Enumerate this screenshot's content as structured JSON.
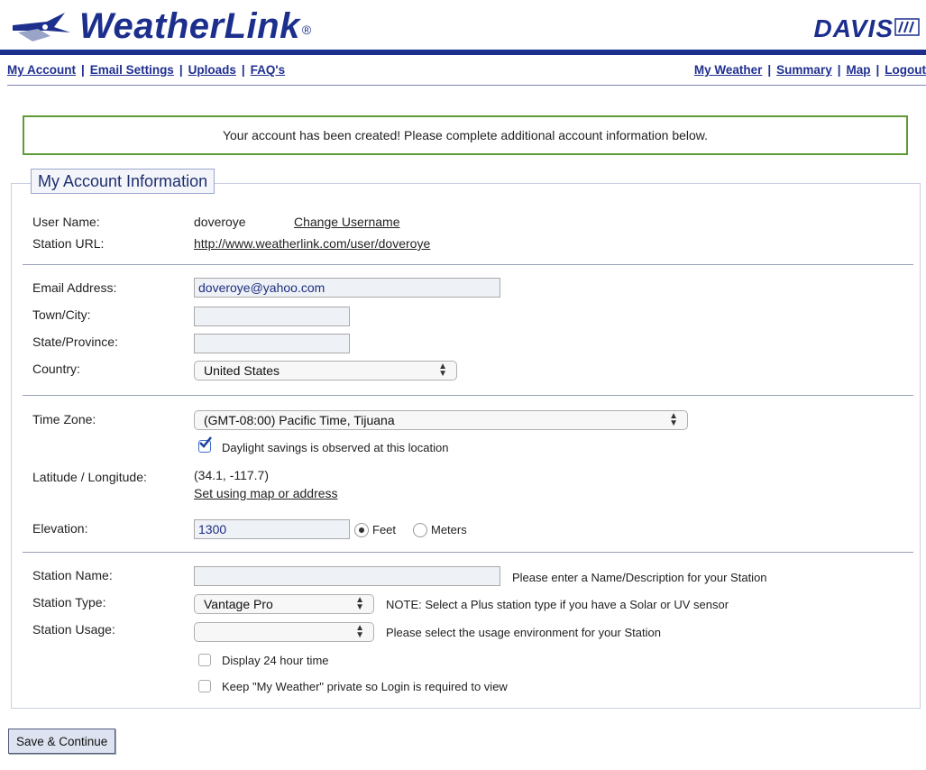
{
  "header": {
    "logo_text": "WeatherLink",
    "logo_mark": "®",
    "brand_text": "DAVIS"
  },
  "nav": {
    "left": [
      "My Account",
      "Email Settings",
      "Uploads",
      "FAQ's"
    ],
    "right": [
      "My Weather",
      "Summary",
      "Map",
      "Logout"
    ],
    "separator": "|"
  },
  "notice": {
    "text": "Your account has been created! Please complete additional account information below."
  },
  "panel": {
    "title": "My Account Information"
  },
  "account": {
    "user_name_label": "User Name:",
    "user_name_value": "doveroye",
    "change_username_link": "Change Username",
    "station_url_label": "Station URL:",
    "station_url_value": "http://www.weatherlink.com/user/doveroye"
  },
  "contact": {
    "email_label": "Email Address:",
    "email_value": "doveroye@yahoo.com",
    "town_label": "Town/City:",
    "town_value": "",
    "state_label": "State/Province:",
    "state_value": "",
    "country_label": "Country:",
    "country_value": "United States"
  },
  "location": {
    "time_zone_label": "Time Zone:",
    "time_zone_value": "(GMT-08:00) Pacific Time, Tijuana",
    "dst_label": "Daylight savings is observed at this location",
    "dst_checked": true,
    "latlon_label": "Latitude / Longitude:",
    "latlon_value": "(34.1, -117.7)",
    "set_map_link": "Set using map or address",
    "elevation_label": "Elevation:",
    "elevation_value": "1300",
    "unit_feet": "Feet",
    "unit_meters": "Meters",
    "unit_selected": "Feet"
  },
  "station": {
    "name_label": "Station Name:",
    "name_value": "",
    "name_hint": "Please enter a Name/Description for your Station",
    "type_label": "Station Type:",
    "type_value": "Vantage Pro",
    "type_hint": "NOTE: Select a Plus station type if you have a Solar or UV sensor",
    "usage_label": "Station Usage:",
    "usage_value": "",
    "usage_hint": "Please select the usage environment for your Station",
    "time24_label": "Display 24 hour time",
    "time24_checked": false,
    "private_label": "Keep \"My Weather\" private so Login is required to view",
    "private_checked": false
  },
  "actions": {
    "save_label": "Save & Continue"
  },
  "colors": {
    "brand_blue": "#1c2f8c",
    "link_blue": "#1f2f8f",
    "notice_border": "#5f9a3a"
  }
}
